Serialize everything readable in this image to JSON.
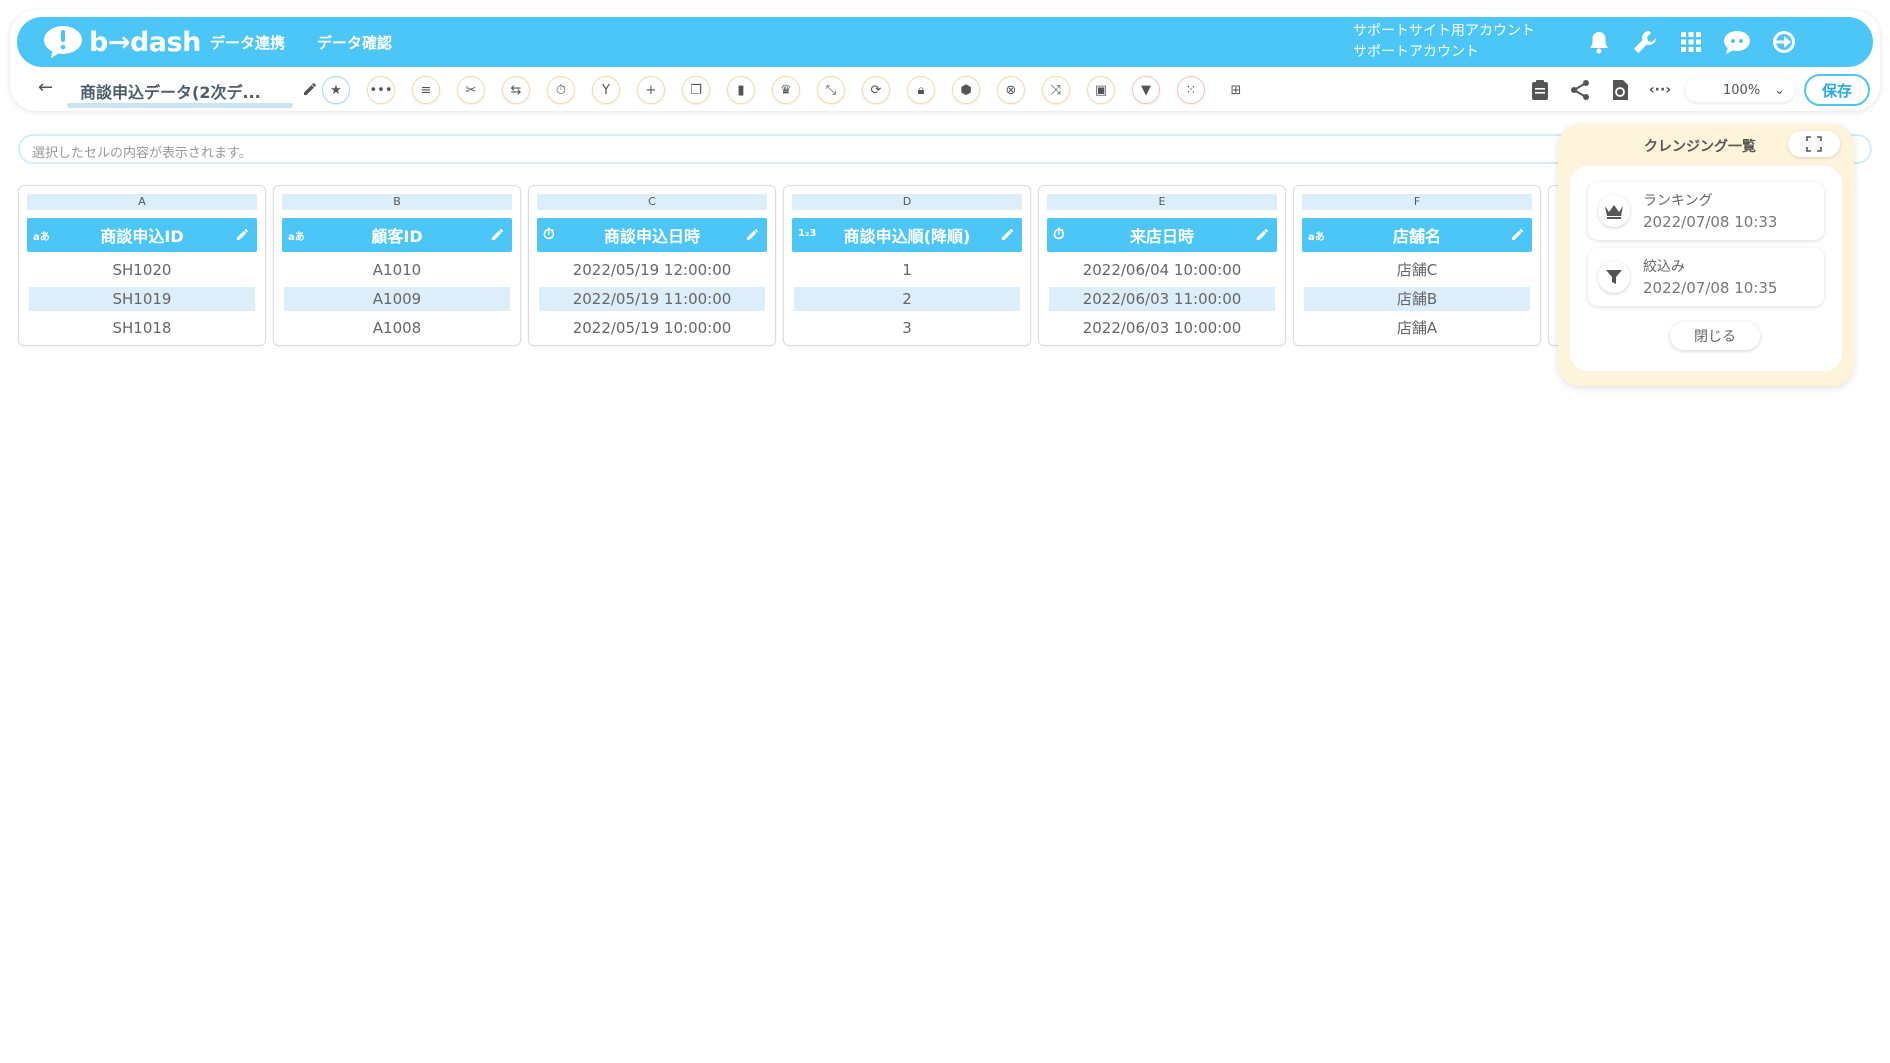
{
  "app": {
    "logo_text": "b→dash",
    "nav": [
      "データ連携",
      "データ確認"
    ],
    "account_line1": "サポートサイト用アカウント",
    "account_line2": "サポートアカウント",
    "accent_color": "#4cc6f6"
  },
  "toolbar": {
    "back_icon": "←",
    "title": "商談申込データ(2次デ...",
    "tools": [
      "star-icon",
      "more-icon",
      "list-icon",
      "cut-icon",
      "merge-icon",
      "timer-icon",
      "branch-icon",
      "plus-icon",
      "copy-icon",
      "trash-icon",
      "crown-icon",
      "collapse-icon",
      "swap-icon",
      "lock-icon",
      "box-icon",
      "close-circle-icon",
      "convert-icon",
      "frame-icon",
      "filter-icon",
      "grid-dots-icon",
      "table-icon"
    ],
    "zoom": "100%",
    "save_label": "保存"
  },
  "cellbar": {
    "placeholder": "選択したセルの内容が表示されます。"
  },
  "columns": [
    {
      "letter": "A",
      "type": "aあ",
      "type_icon": "text-type-icon",
      "name": "商談申込ID",
      "cells": [
        "SH1020",
        "SH1019",
        "SH1018"
      ]
    },
    {
      "letter": "B",
      "type": "aあ",
      "type_icon": "text-type-icon",
      "name": "顧客ID",
      "cells": [
        "A1010",
        "A1009",
        "A1008"
      ]
    },
    {
      "letter": "C",
      "type": "⏱",
      "type_icon": "datetime-type-icon",
      "name": "商談申込日時",
      "cells": [
        "2022/05/19 12:00:00",
        "2022/05/19 11:00:00",
        "2022/05/19 10:00:00"
      ]
    },
    {
      "letter": "D",
      "type": "1₂3",
      "type_icon": "number-type-icon",
      "name": "商談申込順(降順)",
      "cells": [
        "1",
        "2",
        "3"
      ]
    },
    {
      "letter": "E",
      "type": "⏱",
      "type_icon": "datetime-type-icon",
      "name": "来店日時",
      "cells": [
        "2022/06/04 10:00:00",
        "2022/06/03 11:00:00",
        "2022/06/03 10:00:00"
      ]
    },
    {
      "letter": "F",
      "type": "aあ",
      "type_icon": "text-type-icon",
      "name": "店舗名",
      "cells": [
        "店舗C",
        "店舗B",
        "店舗A"
      ]
    }
  ],
  "panel": {
    "title": "クレンジング一覧",
    "entries": [
      {
        "name": "ランキング",
        "date": "2022/07/08 10:33",
        "icon": "crown-icon"
      },
      {
        "name": "絞込み",
        "date": "2022/07/08 10:35",
        "icon": "filter-icon"
      }
    ],
    "close_label": "閉じる"
  }
}
